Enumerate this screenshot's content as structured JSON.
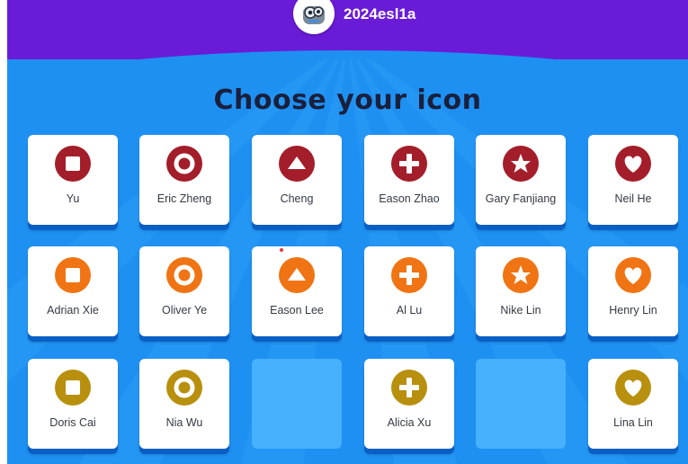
{
  "header": {
    "class_name": "2024esl1a",
    "accent": "#6a1bd8"
  },
  "page": {
    "title": "Choose your icon",
    "background": "#1e90f2"
  },
  "colors": {
    "red": "#a31e2a",
    "orange": "#f07413",
    "gold": "#b8900e"
  },
  "cards": [
    {
      "name": "Yu",
      "shape": "square",
      "color": "red",
      "icon": "square-icon"
    },
    {
      "name": "Eric Zheng",
      "shape": "circle",
      "color": "red",
      "icon": "circle-icon"
    },
    {
      "name": "Cheng",
      "shape": "triangle",
      "color": "red",
      "icon": "triangle-icon"
    },
    {
      "name": "Eason Zhao",
      "shape": "plus",
      "color": "red",
      "icon": "plus-icon"
    },
    {
      "name": "Gary Fanjiang",
      "shape": "star",
      "color": "red",
      "icon": "star-icon"
    },
    {
      "name": "Neil He",
      "shape": "heart",
      "color": "red",
      "icon": "heart-icon"
    },
    {
      "name": "Adrian Xie",
      "shape": "square",
      "color": "orange",
      "icon": "square-icon"
    },
    {
      "name": "Oliver Ye",
      "shape": "circle",
      "color": "orange",
      "icon": "circle-icon"
    },
    {
      "name": "Eason Lee",
      "shape": "triangle",
      "color": "orange",
      "icon": "triangle-icon"
    },
    {
      "name": "Al Lu",
      "shape": "plus",
      "color": "orange",
      "icon": "plus-icon"
    },
    {
      "name": "Nike Lin",
      "shape": "star",
      "color": "orange",
      "icon": "star-icon"
    },
    {
      "name": "Henry Lin",
      "shape": "heart",
      "color": "orange",
      "icon": "heart-icon"
    },
    {
      "name": "Doris Cai",
      "shape": "square",
      "color": "gold",
      "icon": "square-icon"
    },
    {
      "name": "Nia Wu",
      "shape": "circle",
      "color": "gold",
      "icon": "circle-icon"
    },
    {
      "name": "",
      "shape": "none",
      "color": "none",
      "empty": true
    },
    {
      "name": "Alicia Xu",
      "shape": "plus",
      "color": "gold",
      "icon": "plus-icon"
    },
    {
      "name": "",
      "shape": "none",
      "color": "none",
      "empty": true
    },
    {
      "name": "Lina Lin",
      "shape": "heart",
      "color": "gold",
      "icon": "heart-icon"
    }
  ]
}
